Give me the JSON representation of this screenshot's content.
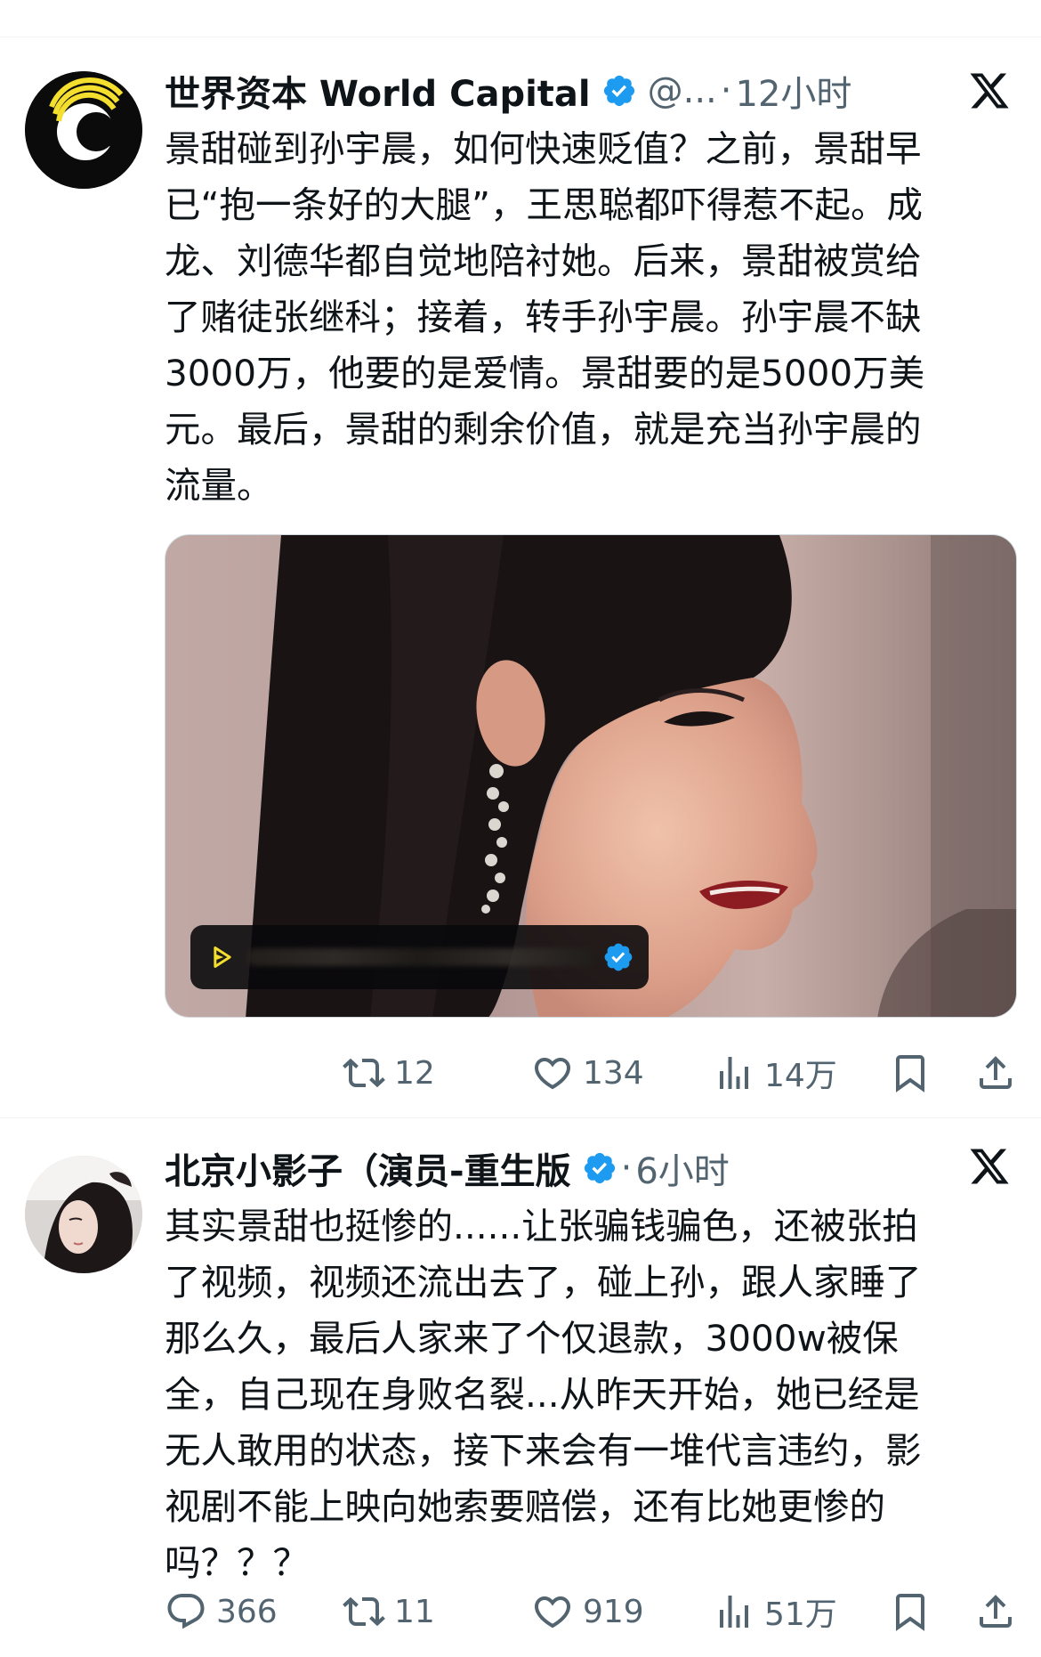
{
  "tweets": [
    {
      "author_name": "世界资本 World Capital",
      "handle": "@...",
      "separator": "·",
      "time": "12小时",
      "text_lines": [
        "景甜碰到孙宇晨，如何快速贬值？之前，景甜早",
        "已“抱一条好的大腿”，王思聪都吓得惹不起。成",
        "龙、刘德华都自觉地陪衬她。后来，景甜被赏给",
        "了赌徒张继科；接着，转手孙宇晨。孙宇晨不缺",
        "3000万，他要的是爱情。景甜要的是5000万美",
        "元。最后，景甜的剩余价值，就是充当孙宇晨的",
        "流量。"
      ],
      "actions": {
        "retweets": "12",
        "likes": "134",
        "views": "14万"
      }
    },
    {
      "author_name": "北京小影子（演员-重生版",
      "separator": "·",
      "time": "6小时",
      "text_lines": [
        "其实景甜也挺惨的......让张骗钱骗色，还被张拍",
        "了视频，视频还流出去了，碰上孙，跟人家睡了",
        "那么久，最后人家来了个仅退款，3000w被保",
        "全，自己现在身败名裂...从昨天开始，她已经是",
        "无人敢用的状态，接下来会有一堆代言违约，影",
        "视剧不能上映向她索要赔偿，还有比她更惨的",
        "吗？？？"
      ],
      "actions": {
        "replies": "366",
        "retweets": "11",
        "likes": "919",
        "views": "51万"
      }
    }
  ],
  "colors": {
    "verified_blue": "#1d9bf0",
    "secondary_text": "#536471",
    "primary_text": "#0f1419"
  }
}
